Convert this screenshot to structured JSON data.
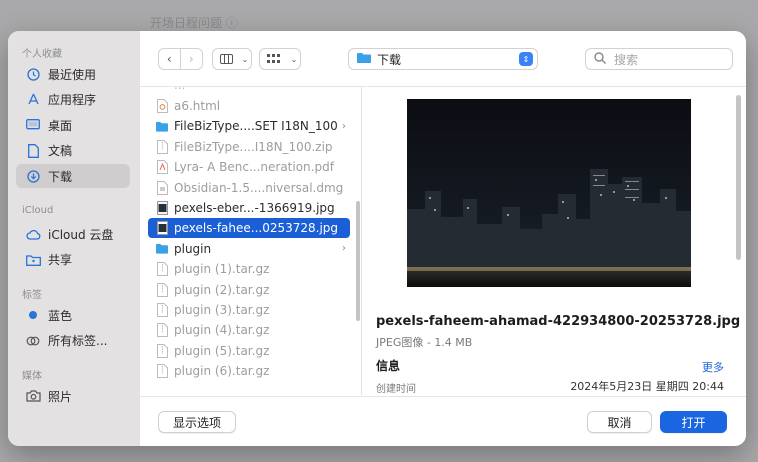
{
  "background": {
    "title": "开场日程问题 ⓘ"
  },
  "sidebar": {
    "sections": [
      {
        "label": "个人收藏",
        "items": [
          {
            "label": "最近使用",
            "icon": "clock-icon"
          },
          {
            "label": "应用程序",
            "icon": "apps-icon"
          },
          {
            "label": "桌面",
            "icon": "desktop-icon"
          },
          {
            "label": "文稿",
            "icon": "document-icon"
          },
          {
            "label": "下载",
            "icon": "download-icon",
            "selected": true
          }
        ]
      },
      {
        "label": "iCloud",
        "items": [
          {
            "label": "iCloud 云盘",
            "icon": "cloud-icon"
          },
          {
            "label": "共享",
            "icon": "shared-folder-icon"
          }
        ]
      },
      {
        "label": "标签",
        "items": [
          {
            "label": "蓝色",
            "icon": "blue-dot-icon"
          },
          {
            "label": "所有标签...",
            "icon": "tags-icon"
          }
        ]
      },
      {
        "label": "媒体",
        "items": [
          {
            "label": "照片",
            "icon": "camera-icon"
          }
        ]
      }
    ]
  },
  "toolbar": {
    "location": "下载",
    "search_placeholder": "搜索"
  },
  "files": [
    {
      "name": "a6.html",
      "type": "html",
      "dim": true
    },
    {
      "name": "FileBizType....SET I18N_100",
      "type": "folder",
      "dim": false,
      "has_children": true
    },
    {
      "name": "FileBizType....I18N_100.zip",
      "type": "zip",
      "dim": true
    },
    {
      "name": "Lyra- A Benc...neration.pdf",
      "type": "pdf",
      "dim": true
    },
    {
      "name": "Obsidian-1.5....niversal.dmg",
      "type": "dmg",
      "dim": true
    },
    {
      "name": "pexels-eber...-1366919.jpg",
      "type": "image",
      "dim": false
    },
    {
      "name": "pexels-fahee...0253728.jpg",
      "type": "image",
      "dim": false,
      "selected": true
    },
    {
      "name": "plugin",
      "type": "folder",
      "dim": false,
      "has_children": true
    },
    {
      "name": "plugin (1).tar.gz",
      "type": "archive",
      "dim": true
    },
    {
      "name": "plugin (2).tar.gz",
      "type": "archive",
      "dim": true
    },
    {
      "name": "plugin (3).tar.gz",
      "type": "archive",
      "dim": true
    },
    {
      "name": "plugin (4).tar.gz",
      "type": "archive",
      "dim": true
    },
    {
      "name": "plugin (5).tar.gz",
      "type": "archive",
      "dim": true
    },
    {
      "name": "plugin (6).tar.gz",
      "type": "archive",
      "dim": true
    }
  ],
  "preview": {
    "filename": "pexels-faheem-ahamad-422934800-20253728.jpg",
    "kind": "JPEG图像 - 1.4 MB",
    "info_label": "信息",
    "more_label": "更多",
    "created_label": "创建时间",
    "created_value": "2024年5月23日 星期四 20:44"
  },
  "footer": {
    "options_label": "显示选项",
    "cancel_label": "取消",
    "open_label": "打开"
  },
  "colors": {
    "accent": "#1a65e0",
    "selection": "#1a5fd5",
    "folder": "#3aa0e8"
  }
}
